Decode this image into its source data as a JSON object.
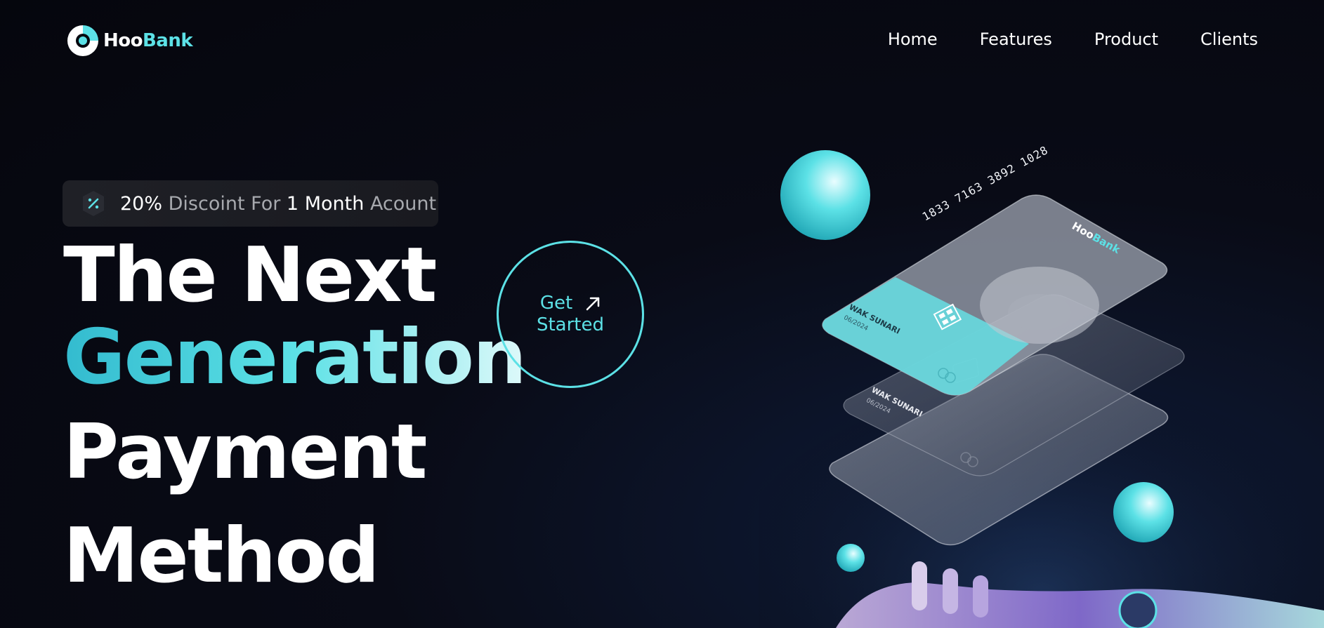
{
  "brand": {
    "part1": "Hoo",
    "part2": "Bank"
  },
  "nav": [
    "Home",
    "Features",
    "Product",
    "Clients"
  ],
  "badge": {
    "percent": "20%",
    "discount": "Discoint",
    "for": "For",
    "one": "1",
    "month": "Month",
    "account": "Acount"
  },
  "headline": {
    "line1": "The Next",
    "line2": "Generation",
    "line3": "Payment",
    "line4": "Method"
  },
  "cta": {
    "line1": "Get",
    "line2": "Started"
  },
  "card": {
    "number": "1833 7163 3892 1028",
    "name": "WAK SUNARI",
    "expiry": "06/2024",
    "brand1": "Hoo",
    "brand2": "Bank"
  },
  "colors": {
    "accent": "#5ce1e6",
    "background": "#05060d"
  }
}
